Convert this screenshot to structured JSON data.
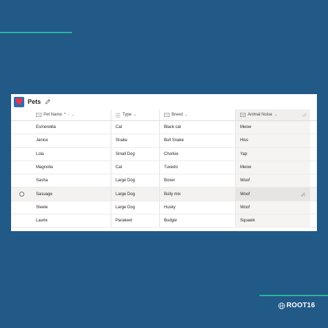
{
  "list": {
    "title": "Pets",
    "columns": [
      {
        "label": "Pet Name",
        "suffix": "*",
        "sort": "↑",
        "chevron": "⌄",
        "icon": "text-column-icon"
      },
      {
        "label": "Type",
        "chevron": "⌄",
        "icon": "choice-column-icon"
      },
      {
        "label": "Breed",
        "chevron": "⌄",
        "icon": "text-column-icon"
      },
      {
        "label": "Animal Noise",
        "chevron": "⌄",
        "icon": "text-column-icon"
      }
    ],
    "rows": [
      {
        "name": "Esmerelda",
        "type": "Cat",
        "breed": "Black cat",
        "noise": "Meow"
      },
      {
        "name": "Janice",
        "type": "Snake",
        "breed": "Bull Snake",
        "noise": "Hiss"
      },
      {
        "name": "Lola",
        "type": "Small Dog",
        "breed": "Chorkie",
        "noise": "Yap"
      },
      {
        "name": "Magnolia",
        "type": "Cat",
        "breed": "Tuxedo",
        "noise": "Meow"
      },
      {
        "name": "Sasha",
        "type": "Large Dog",
        "breed": "Boxer",
        "noise": "Woof"
      },
      {
        "name": "Sasuage",
        "type": "Large Dog",
        "breed": "Bully mix",
        "noise": "Woof"
      },
      {
        "name": "Steele",
        "type": "Large Dog",
        "breed": "Husky",
        "noise": "Woof"
      },
      {
        "name": "Laurie",
        "type": "Parakeet",
        "breed": "Budgie",
        "noise": "Squawk"
      }
    ],
    "hovered_row": 5
  },
  "brand": {
    "name": "ROOT16"
  },
  "colors": {
    "background": "#215a87",
    "accent": "#2fb59a",
    "list_icon": "#2f6db0",
    "heart": "#e8344e"
  }
}
